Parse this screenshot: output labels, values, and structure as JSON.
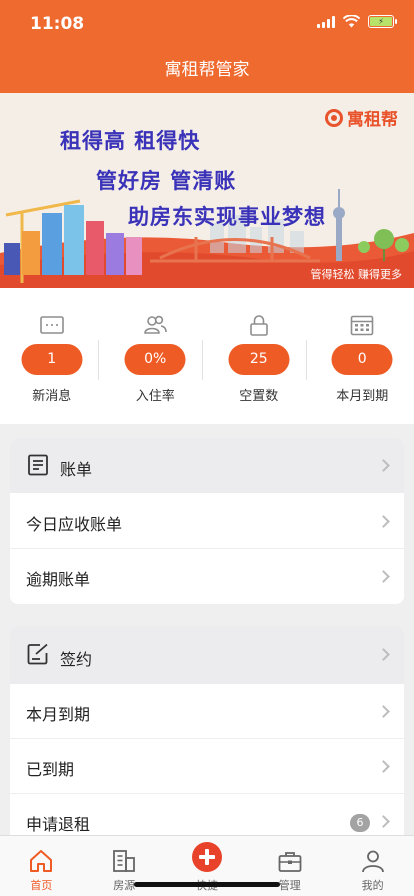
{
  "status_bar": {
    "time": "11:08",
    "icons": [
      "signal-icon",
      "wifi-icon",
      "battery-charging-icon"
    ],
    "battery_color": "#b7e36b"
  },
  "nav": {
    "title": "寓租帮管家"
  },
  "banner": {
    "logo_text": "寓租帮",
    "slogan_1": "租得高 租得快",
    "slogan_2": "管好房 管清账",
    "slogan_3": "助房东实现事业梦想",
    "sub": "管得轻松 赚得更多"
  },
  "stats": [
    {
      "icon": "message-icon",
      "value": "1",
      "label": "新消息"
    },
    {
      "icon": "users-icon",
      "value": "0%",
      "label": "入住率"
    },
    {
      "icon": "lock-icon",
      "value": "25",
      "label": "空置数"
    },
    {
      "icon": "calendar-icon",
      "value": "0",
      "label": "本月到期"
    }
  ],
  "bills": {
    "header": "账单",
    "icon": "bill-icon",
    "items": [
      "今日应收账单",
      "逾期账单"
    ]
  },
  "contracts": {
    "header": "签约",
    "icon": "sign-icon",
    "items": [
      "本月到期",
      "已到期",
      "申请退租"
    ],
    "badge": "6"
  },
  "tabbar": [
    {
      "icon": "home-icon",
      "label": "首页",
      "active": true
    },
    {
      "icon": "building-icon",
      "label": "房源",
      "active": false
    },
    {
      "icon": "plus-icon",
      "label": "快捷",
      "active": false
    },
    {
      "icon": "briefcase-icon",
      "label": "管理",
      "active": false
    },
    {
      "icon": "user-icon",
      "label": "我的",
      "active": false
    }
  ],
  "colors": {
    "accent": "#ef5b25",
    "header": "#ef6a2f",
    "banner_text": "#3a32b8"
  }
}
